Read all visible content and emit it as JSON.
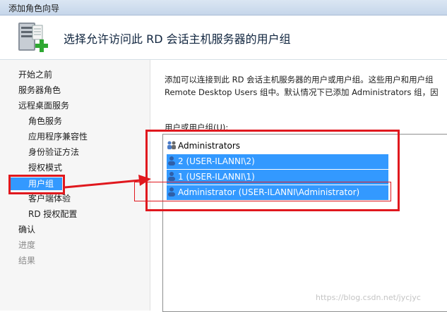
{
  "window": {
    "title": "添加角色向导"
  },
  "header": {
    "heading": "选择允许访问此 RD 会话主机服务器的用户组",
    "icon": "server-add-icon"
  },
  "sidebar": {
    "items": [
      {
        "label": "开始之前",
        "level": 0,
        "state": "normal"
      },
      {
        "label": "服务器角色",
        "level": 0,
        "state": "normal"
      },
      {
        "label": "远程桌面服务",
        "level": 0,
        "state": "normal"
      },
      {
        "label": "角色服务",
        "level": 1,
        "state": "normal"
      },
      {
        "label": "应用程序兼容性",
        "level": 1,
        "state": "normal"
      },
      {
        "label": "身份验证方法",
        "level": 1,
        "state": "normal"
      },
      {
        "label": "授权模式",
        "level": 1,
        "state": "normal"
      },
      {
        "label": "用户组",
        "level": 1,
        "state": "selected"
      },
      {
        "label": "客户端体验",
        "level": 1,
        "state": "normal"
      },
      {
        "label": "RD 授权配置",
        "level": 1,
        "state": "normal"
      },
      {
        "label": "确认",
        "level": 0,
        "state": "normal"
      },
      {
        "label": "进度",
        "level": 0,
        "state": "disabled"
      },
      {
        "label": "结果",
        "level": 0,
        "state": "disabled"
      }
    ]
  },
  "content": {
    "desc_line1": "添加可以连接到此 RD 会话主机服务器的用户或用户组。这些用户和用户组",
    "desc_line2": "Remote Desktop Users 组中。默认情况下已添加 Administrators 组，因",
    "group_label": "用户或用户组(U):",
    "list": [
      {
        "label": "Administrators",
        "icon": "group-icon",
        "selected": false
      },
      {
        "label": "2 (USER-ILANNI\\2)",
        "icon": "user-icon",
        "selected": true
      },
      {
        "label": "1 (USER-ILANNI\\1)",
        "icon": "user-icon",
        "selected": true
      },
      {
        "label": "Administrator (USER-ILANNI\\Administrator)",
        "icon": "user-icon",
        "selected": true
      }
    ]
  },
  "annotations": {
    "color": "#e0181e"
  },
  "watermark": "https://blog.csdn.net/jycjyc"
}
